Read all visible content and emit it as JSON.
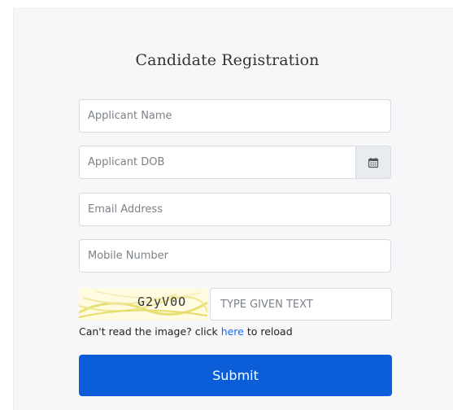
{
  "form": {
    "title": "Candidate Registration",
    "name_placeholder": "Applicant Name",
    "dob_placeholder": "Applicant DOB",
    "email_placeholder": "Email Address",
    "mobile_placeholder": "Mobile Number",
    "captcha_text": "G2yV0O",
    "captcha_input_placeholder": "TYPE GIVEN TEXT",
    "reload_prefix": "Can't read the image? click ",
    "reload_link": "here",
    "reload_suffix": " to reload",
    "submit_label": "Submit"
  },
  "icons": {
    "calendar": "calendar-icon"
  },
  "colors": {
    "primary": "#0b5ed7",
    "link": "#0d6efd",
    "panel_bg": "#f7f7f9"
  }
}
